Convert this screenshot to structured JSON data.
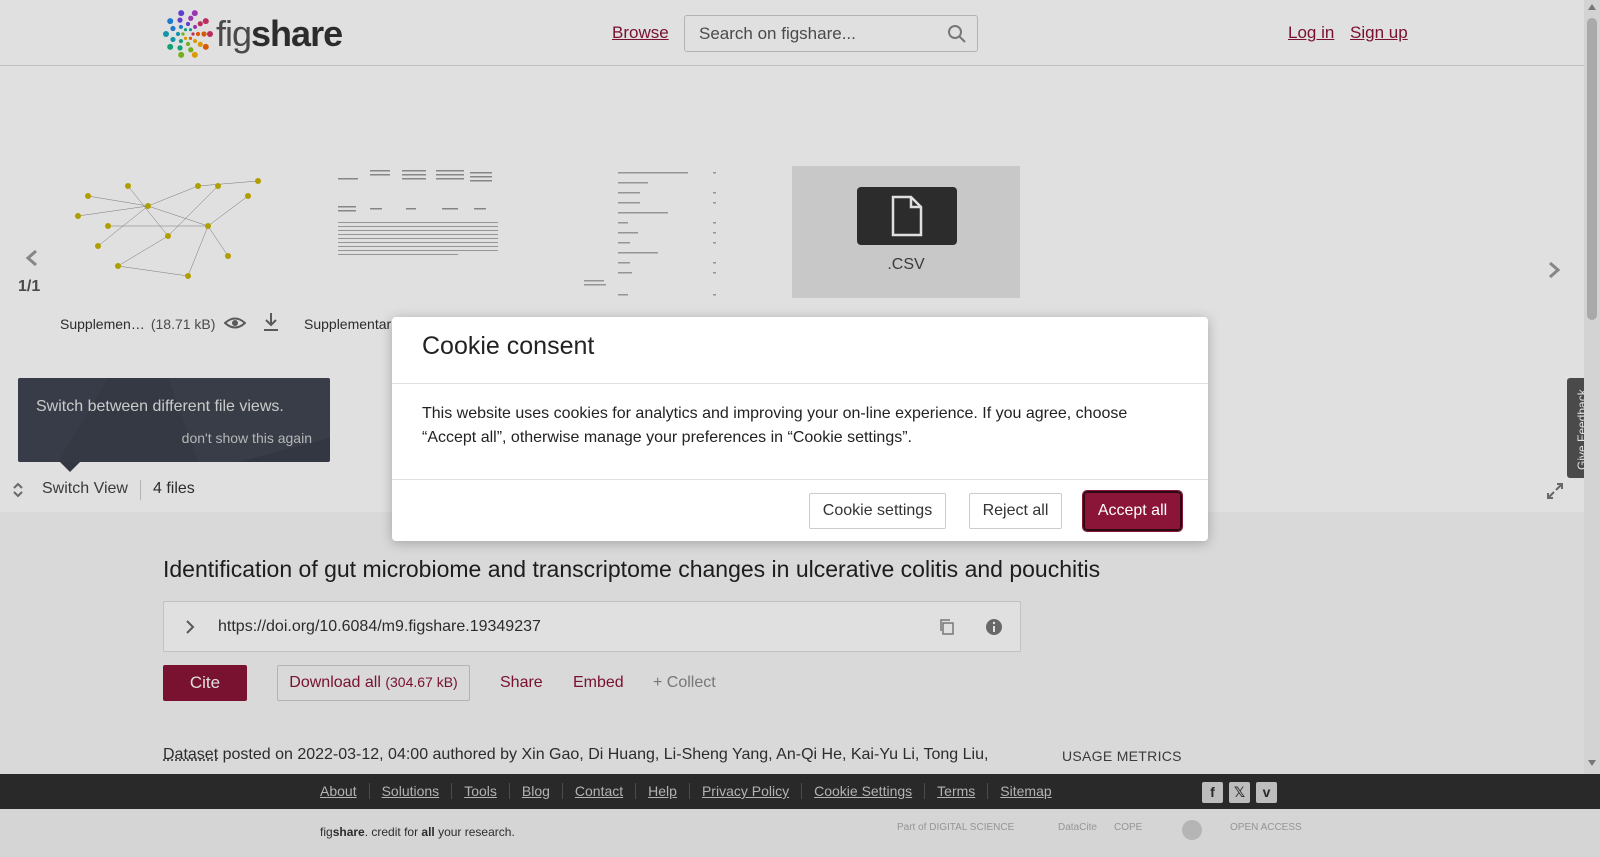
{
  "header": {
    "logo_text_light": "fig",
    "logo_text_bold": "share",
    "browse_label": "Browse",
    "search_placeholder": "Search on figshare...",
    "login_label": "Log in",
    "signup_label": "Sign up"
  },
  "viewer": {
    "page_counter": "1/1",
    "files": [
      {
        "name": "Supplemen…",
        "size": "(18.71 kB)"
      },
      {
        "name": "Supplementar"
      },
      {
        "name": ""
      },
      {
        "name": "",
        "placeholder_ext": ".CSV"
      }
    ],
    "tooltip_text": "Switch between different file views.",
    "tooltip_dismiss": "don't show this again",
    "switch_view_label": "Switch View",
    "file_count": "4 files"
  },
  "feedback_label": "Give Feedback",
  "article": {
    "title": "Identification of gut microbiome and transcriptome changes in ulcerative colitis and pouchitis",
    "doi": "https://doi.org/10.6084/m9.figshare.19349237",
    "cite_label": "Cite",
    "download_label": "Download all",
    "download_size": "(304.67 kB)",
    "share_label": "Share",
    "embed_label": "Embed",
    "collect_label": "+ Collect",
    "item_type": "Dataset",
    "posted_text": " posted on 2022-03-12, 04:00 authored by Xin Gao, Di Huang, Li-Sheng Yang, An-Qi He, Kai-Yu Li, Tong Liu,",
    "usage_metrics_label": "USAGE METRICS"
  },
  "footer": {
    "links": [
      "About",
      "Solutions",
      "Tools",
      "Blog",
      "Contact",
      "Help",
      "Privacy Policy",
      "Cookie Settings",
      "Terms",
      "Sitemap"
    ],
    "social_icons": [
      "facebook-icon",
      "x-icon",
      "vimeo-icon"
    ],
    "tagline_light": "fig",
    "tagline_bold": "share",
    "tagline_mid": ". credit for ",
    "tagline_all": "all",
    "tagline_end": " your research.",
    "partners": [
      "Part of DIGITAL SCIENCE",
      "DataCite",
      "COPE",
      "",
      "OPEN ACCESS"
    ]
  },
  "cookie_modal": {
    "title": "Cookie consent",
    "body": "This website uses cookies for analytics and improving your on-line experience. If you agree, choose “Accept all”, otherwise manage your preferences in “Cookie settings”.",
    "settings_label": "Cookie settings",
    "reject_label": "Reject all",
    "accept_label": "Accept all"
  },
  "colors": {
    "brand": "#8a1538",
    "footer_dark": "#2f2f2f",
    "tooltip_bg": "#3a3f4c"
  }
}
